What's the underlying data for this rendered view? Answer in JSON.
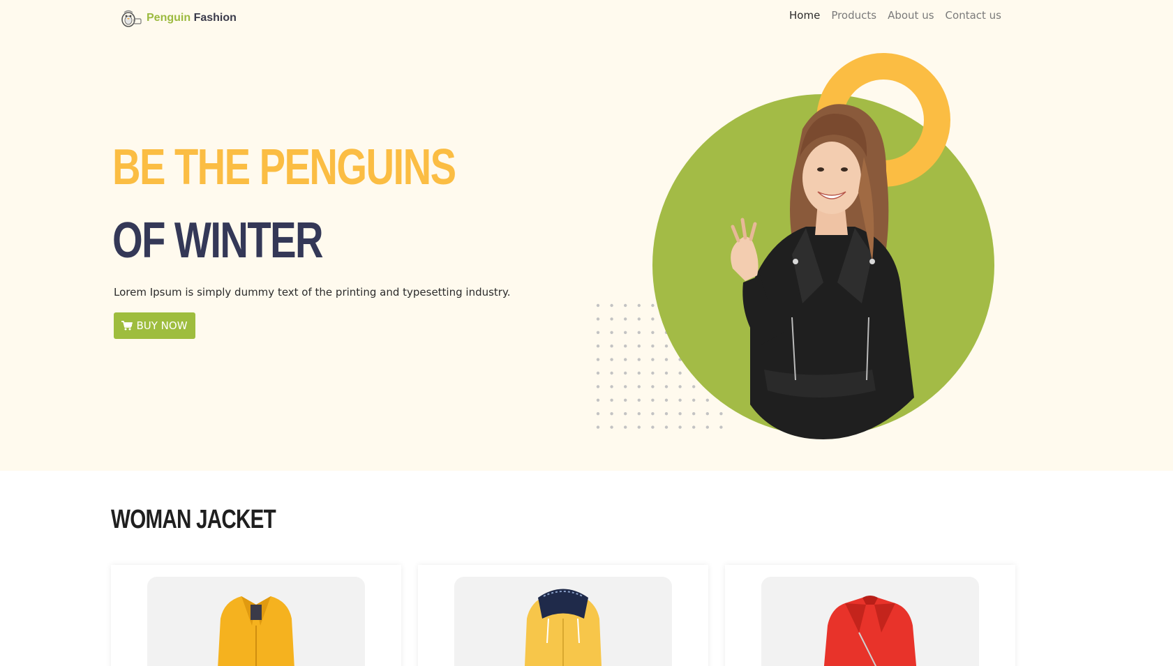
{
  "brand": {
    "name_part1": "Penguin",
    "name_part2": "Fashion"
  },
  "nav": {
    "items": [
      {
        "label": "Home",
        "active": true
      },
      {
        "label": "Products",
        "active": false
      },
      {
        "label": "About us",
        "active": false
      },
      {
        "label": "Contact us",
        "active": false
      }
    ]
  },
  "hero": {
    "title_line1": "BE THE PENGUINS",
    "title_line2": "OF WINTER",
    "description": "Lorem Ipsum is simply dummy text of the printing and typesetting industry.",
    "cta_label": "BUY NOW"
  },
  "products_section": {
    "title": "WOMAN JACKET",
    "items": [
      {
        "color": "#f5b21f"
      },
      {
        "color": "#f7c64a"
      },
      {
        "color": "#e8332a"
      }
    ]
  },
  "colors": {
    "accent_yellow": "#fbbd43",
    "accent_green": "#a3bb46",
    "navy": "#343857",
    "hero_bg": "#fffaee"
  },
  "icons": {
    "cart": "shopping-cart-icon",
    "logo": "penguin-logo-icon"
  }
}
